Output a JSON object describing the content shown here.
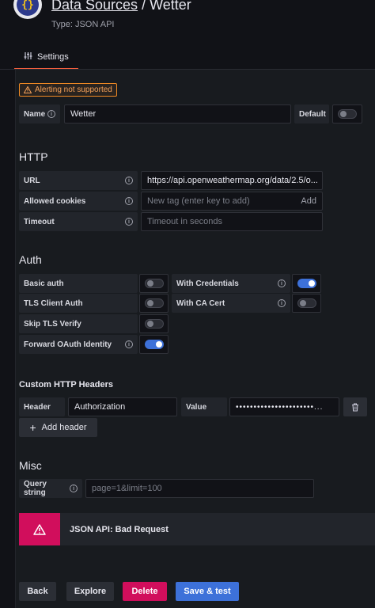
{
  "header": {
    "breadcrumb_link": "Data Sources",
    "separator": " / ",
    "name": "Wetter",
    "type_label": "Type: JSON API",
    "logo_text": "{}"
  },
  "tabs": [
    {
      "label": "Settings",
      "icon": "sliders-icon"
    }
  ],
  "alert_badge": "Alerting not supported",
  "name_row": {
    "label": "Name",
    "value": "Wetter",
    "default_label": "Default",
    "default_on": false
  },
  "http": {
    "title": "HTTP",
    "url_label": "URL",
    "url_value": "https://api.openweathermap.org/data/2.5/o...",
    "cookies_label": "Allowed cookies",
    "cookies_placeholder": "New tag (enter key to add)",
    "cookies_add": "Add",
    "timeout_label": "Timeout",
    "timeout_placeholder": "Timeout in seconds"
  },
  "auth": {
    "title": "Auth",
    "basic_auth": {
      "label": "Basic auth",
      "on": false
    },
    "with_credentials": {
      "label": "With Credentials",
      "on": true
    },
    "tls_client_auth": {
      "label": "TLS Client Auth",
      "on": false
    },
    "with_ca_cert": {
      "label": "With CA Cert",
      "on": false
    },
    "skip_tls_verify": {
      "label": "Skip TLS Verify",
      "on": false
    },
    "forward_oauth": {
      "label": "Forward OAuth Identity",
      "on": true
    }
  },
  "custom_headers": {
    "title": "Custom HTTP Headers",
    "header_label": "Header",
    "header_value": "Authorization",
    "value_label": "Value",
    "value_value": "••••••••••••••••••••••...",
    "add_button": "Add header"
  },
  "misc": {
    "title": "Misc",
    "query_label": "Query string",
    "query_placeholder": "page=1&limit=100"
  },
  "error": {
    "message": "JSON API: Bad Request"
  },
  "footer": {
    "back": "Back",
    "explore": "Explore",
    "delete": "Delete",
    "save_test": "Save & test"
  },
  "colors": {
    "accent_tab": "#f55f3e",
    "primary": "#3d71d9",
    "danger": "#d10e5c",
    "warning": "#f08a24"
  }
}
